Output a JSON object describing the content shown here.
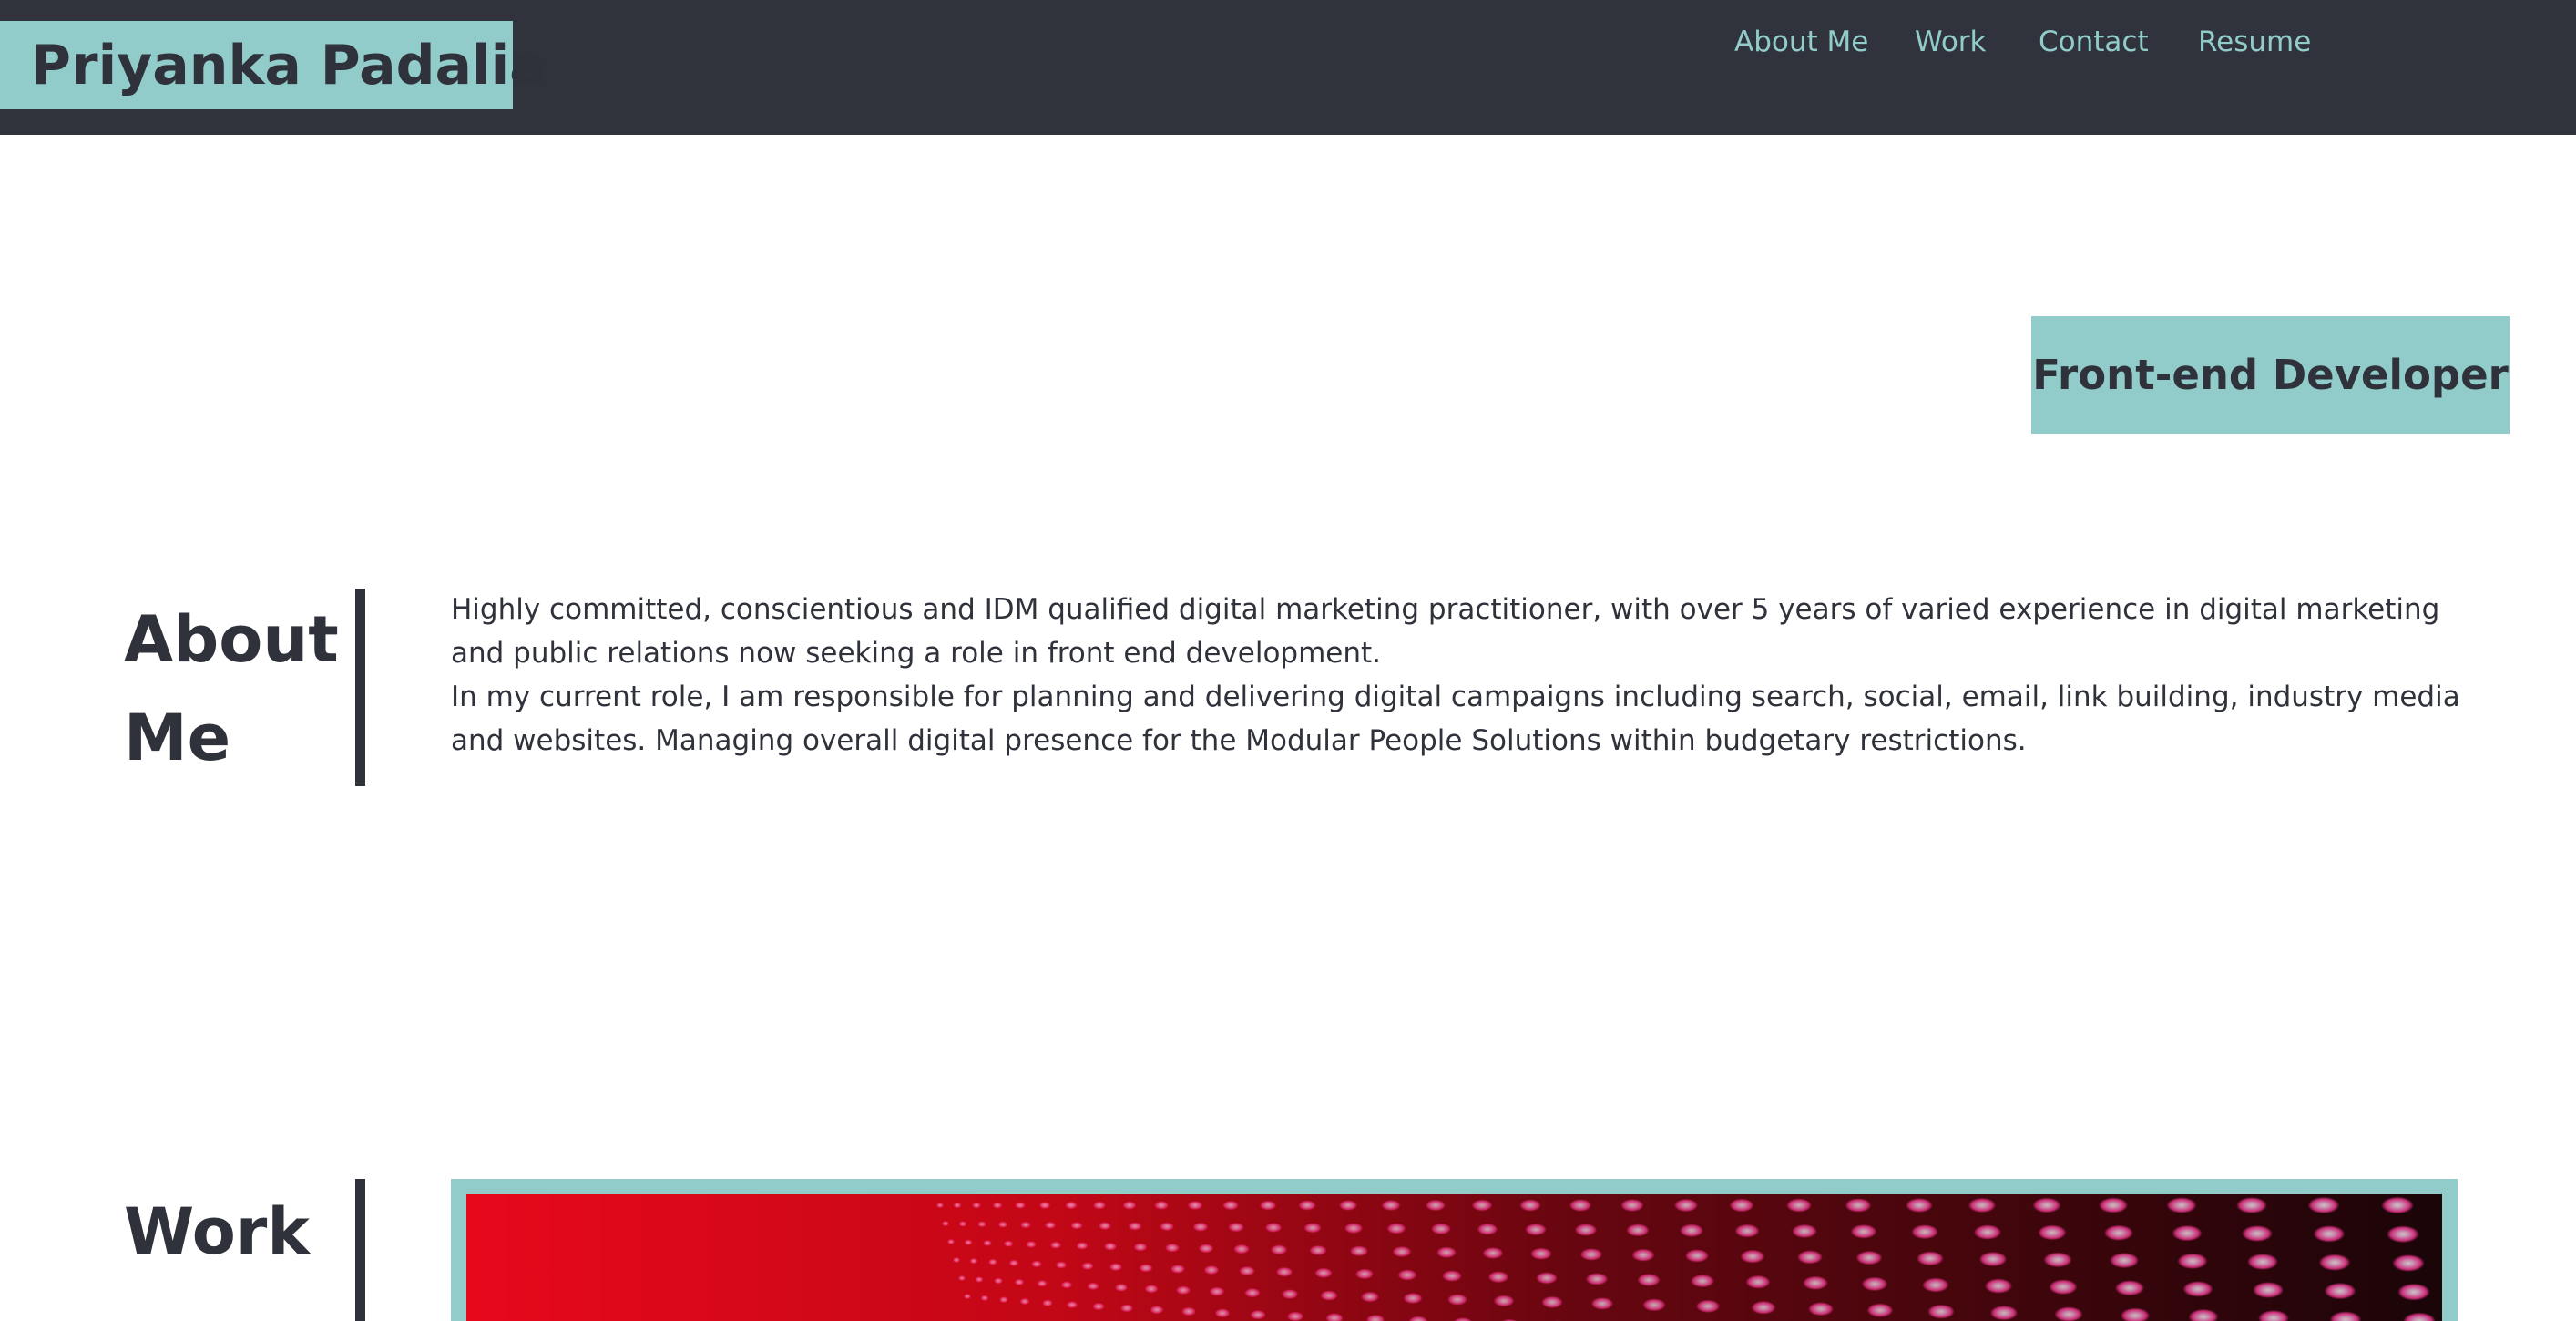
{
  "header": {
    "brand": "Priyanka Padalia",
    "nav": [
      {
        "label": "About Me"
      },
      {
        "label": "Work"
      },
      {
        "label": "Contact"
      },
      {
        "label": "Resume"
      }
    ]
  },
  "hero": {
    "role": "Front-end Developer"
  },
  "about": {
    "title_line1": "About",
    "title_line2": "Me",
    "paragraph1": "Highly committed, conscientious and IDM qualified digital marketing practitioner, with over 5 years of varied experience in digital marketing and public relations now seeking a role in front end development.",
    "paragraph2": "In my current role, I am responsible for planning and delivering digital campaigns including search, social, email, link building, industry media and websites. Managing overall digital presence for the Modular People Solutions within budgetary restrictions."
  },
  "work": {
    "title": "Work"
  },
  "colors": {
    "header_bg": "#31333c",
    "accent": "#91cccb",
    "text": "#2f323a",
    "page_bg": "#ffffff"
  }
}
